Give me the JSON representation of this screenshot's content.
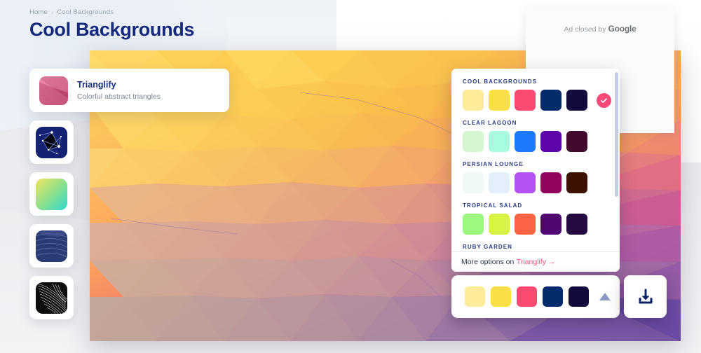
{
  "header": {
    "breadcrumb": {
      "home": "Home",
      "separator": "›",
      "current": "Cool Backgrounds"
    },
    "title": "Cool Backgrounds"
  },
  "info_card": {
    "title": "Trianglify",
    "subtitle": "Colorful abstract triangles",
    "thumb_icon": "trianglify-thumb"
  },
  "sidebar": {
    "items": [
      {
        "name": "particles",
        "icon": "particles-thumb"
      },
      {
        "name": "gradient",
        "icon": "gradient-thumb"
      },
      {
        "name": "waves",
        "icon": "waves-thumb"
      },
      {
        "name": "lines",
        "icon": "lines-thumb"
      }
    ]
  },
  "palette_panel": {
    "groups": [
      {
        "name": "COOL BACKGROUNDS",
        "selected": true,
        "colors": [
          "#ffeb99",
          "#fbdf47",
          "#fb4a72",
          "#042b6b",
          "#120a3d"
        ]
      },
      {
        "name": "CLEAR LAGOON",
        "selected": false,
        "colors": [
          "#d5f7d0",
          "#a7fbdf",
          "#1b7afb",
          "#5e04ab",
          "#430a30"
        ]
      },
      {
        "name": "PERSIAN LOUNGE",
        "selected": false,
        "colors": [
          "#f1f8f8",
          "#e3effb",
          "#b451f2",
          "#91045e",
          "#3c1203"
        ]
      },
      {
        "name": "TROPICAL SALAD",
        "selected": false,
        "colors": [
          "#9cf980",
          "#d9f246",
          "#fb6345",
          "#4f0871",
          "#240a40"
        ]
      },
      {
        "name": "RUBY GARDEN",
        "selected": false,
        "colors": [
          "#f7c6d4",
          "#f07aa0",
          "#c42252",
          "#6d0f2e",
          "#2b0512"
        ]
      }
    ],
    "footer": {
      "text": "More options on",
      "link": "Trianglify →"
    },
    "check_icon": "check-icon",
    "scrollbar": "vertical-scrollbar"
  },
  "toolbar": {
    "colors": [
      "#ffeb99",
      "#fbdf47",
      "#fb4a72",
      "#042b6b",
      "#120a3d"
    ],
    "expand_icon": "caret-up-icon",
    "download_icon": "download-icon"
  },
  "ad": {
    "text": "Ad closed by",
    "brand": "Google"
  },
  "canvas": {
    "name": "trianglify-canvas",
    "palette": [
      "#ffeb99",
      "#fbdf47",
      "#fb4a72",
      "#042b6b",
      "#120a3d"
    ]
  },
  "accent": {
    "pink": "#fb4a72",
    "navy": "#15287b",
    "link_pink": "#f2527c"
  }
}
